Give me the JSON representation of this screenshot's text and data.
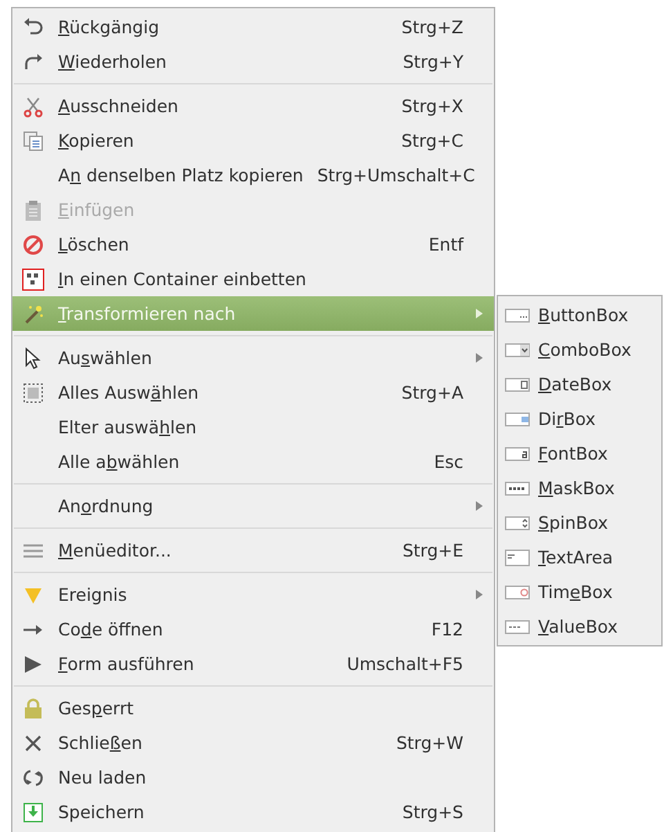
{
  "menu": {
    "sections": [
      {
        "items": [
          {
            "key": "R",
            "post": "ückgängig",
            "shortcut": "Strg+Z",
            "disabled": false,
            "selected": false,
            "submenu": false
          },
          {
            "key": "W",
            "post": "iederholen",
            "shortcut": "Strg+Y",
            "disabled": false,
            "selected": false,
            "submenu": false
          }
        ]
      },
      {
        "items": [
          {
            "key": "A",
            "post": "usschneiden",
            "shortcut": "Strg+X",
            "disabled": false,
            "selected": false,
            "submenu": false
          },
          {
            "key": "K",
            "post": "opieren",
            "shortcut": "Strg+C",
            "disabled": false,
            "selected": false,
            "submenu": false
          },
          {
            "pre": "A",
            "key": "n",
            "post": " denselben Platz kopieren",
            "shortcut": "Strg+Umschalt+C",
            "disabled": false,
            "selected": false,
            "submenu": false
          },
          {
            "key": "E",
            "post": "infügen",
            "disabled": true,
            "selected": false,
            "submenu": false
          },
          {
            "key": "L",
            "post": "öschen",
            "shortcut": "Entf",
            "disabled": false,
            "selected": false,
            "submenu": false
          },
          {
            "key": "I",
            "post": "n einen Container einbetten",
            "disabled": false,
            "selected": false,
            "submenu": false
          },
          {
            "key": "T",
            "post": "ransformieren nach",
            "disabled": false,
            "selected": true,
            "submenu": true
          }
        ]
      },
      {
        "items": [
          {
            "pre": "Au",
            "key": "s",
            "post": "wählen",
            "disabled": false,
            "selected": false,
            "submenu": true
          },
          {
            "pre": "Alles Ausw",
            "key": "ä",
            "post": "hlen",
            "shortcut": "Strg+A",
            "disabled": false,
            "selected": false,
            "submenu": false
          },
          {
            "pre": "Elter auswä",
            "key": "h",
            "post": "len",
            "disabled": false,
            "selected": false,
            "submenu": false
          },
          {
            "pre": "Alle a",
            "key": "b",
            "post": "wählen",
            "shortcut": "Esc",
            "disabled": false,
            "selected": false,
            "submenu": false
          }
        ]
      },
      {
        "items": [
          {
            "pre": "An",
            "key": "o",
            "post": "rdnung",
            "disabled": false,
            "selected": false,
            "submenu": true
          }
        ]
      },
      {
        "items": [
          {
            "key": "M",
            "post": "enüeditor...",
            "shortcut": "Strg+E",
            "disabled": false,
            "selected": false,
            "submenu": false
          }
        ]
      },
      {
        "items": [
          {
            "label": "Ereignis",
            "disabled": false,
            "selected": false,
            "submenu": true
          },
          {
            "pre": "Co",
            "key": "d",
            "post": "e öffnen",
            "shortcut": "F12",
            "disabled": false,
            "selected": false,
            "submenu": false
          },
          {
            "key": "F",
            "post": "orm ausführen",
            "shortcut": "Umschalt+F5",
            "disabled": false,
            "selected": false,
            "submenu": false
          }
        ]
      },
      {
        "items": [
          {
            "pre": "Ges",
            "key": "p",
            "post": "errt",
            "disabled": false,
            "selected": false,
            "submenu": false
          },
          {
            "pre": "Schlie",
            "key": "ß",
            "post": "en",
            "shortcut": "Strg+W",
            "disabled": false,
            "selected": false,
            "submenu": false
          },
          {
            "label": "Neu laden",
            "disabled": false,
            "selected": false,
            "submenu": false
          },
          {
            "label": "Speichern",
            "shortcut": "Strg+S",
            "disabled": false,
            "selected": false,
            "submenu": false
          }
        ]
      }
    ]
  },
  "submenu": {
    "items": [
      {
        "key": "B",
        "post": "uttonBox"
      },
      {
        "key": "C",
        "post": "omboBox"
      },
      {
        "key": "D",
        "post": "ateBox"
      },
      {
        "pre": "Di",
        "key": "r",
        "post": "Box"
      },
      {
        "key": "F",
        "post": "ontBox"
      },
      {
        "key": "M",
        "post": "askBox"
      },
      {
        "key": "S",
        "post": "pinBox"
      },
      {
        "key": "T",
        "post": "extArea"
      },
      {
        "pre": "Tim",
        "key": "e",
        "post": "Box"
      },
      {
        "key": "V",
        "post": "alueBox"
      }
    ]
  }
}
